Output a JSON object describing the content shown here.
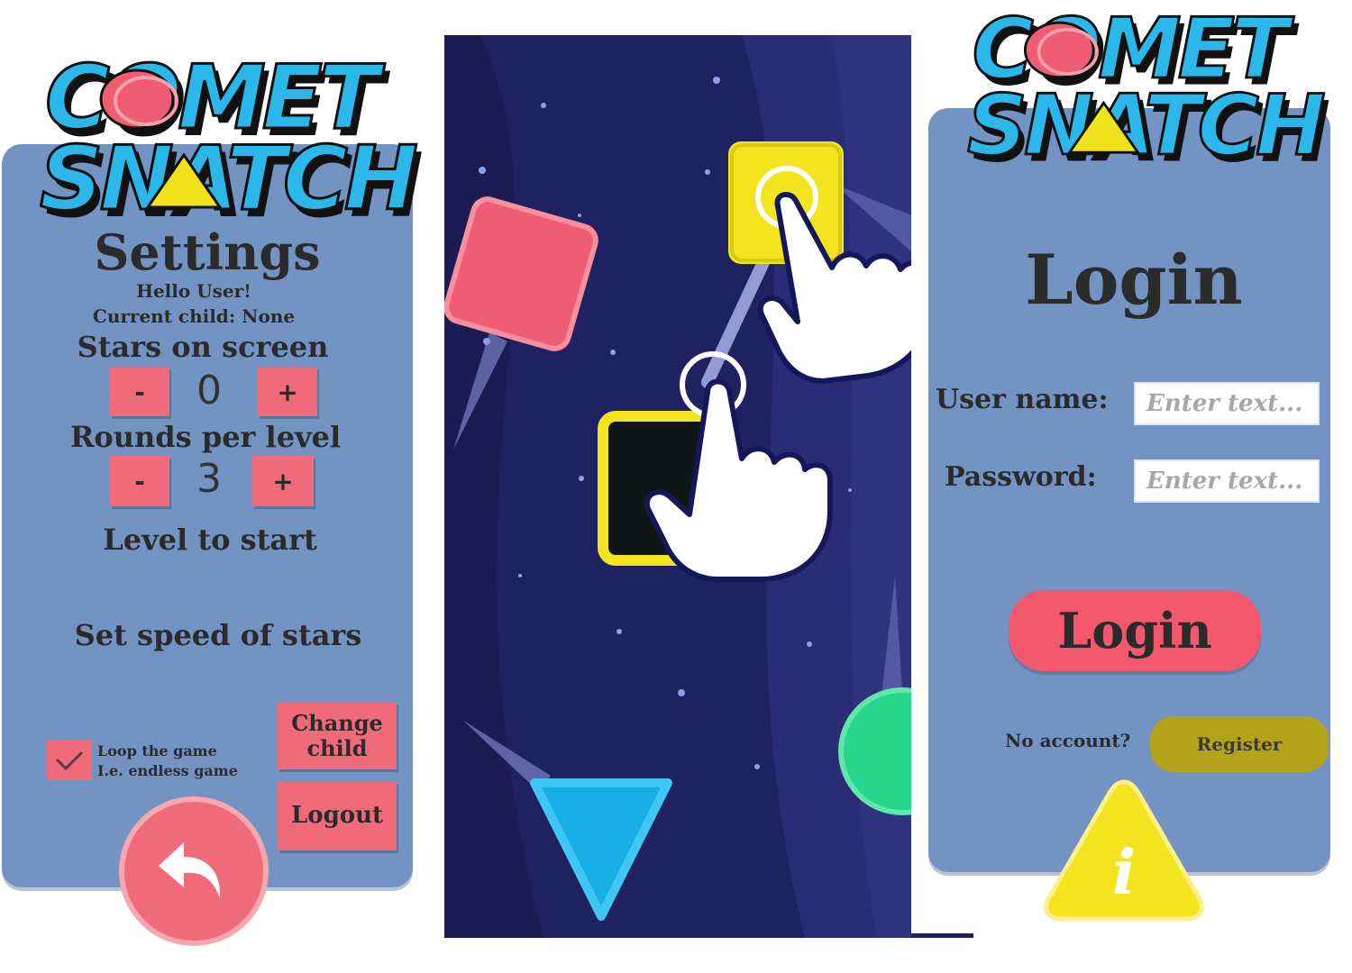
{
  "brand": {
    "line1": "COMET",
    "line2": "SNATCH"
  },
  "settings": {
    "title": "Settings",
    "greeting": "Hello User!",
    "current_child": "Current child: None",
    "stars_label": "Stars on screen",
    "stars_value": "0",
    "rounds_label": "Rounds per level",
    "rounds_value": "3",
    "minus": "-",
    "plus": "+",
    "level_label": "Level to start",
    "speed_label": "Set speed of stars",
    "loop_label_1": "Loop the game",
    "loop_label_2": "I.e. endless game",
    "loop_checked": true,
    "change_child_1": "Change",
    "change_child_2": "child",
    "logout": "Logout"
  },
  "game": {
    "shapes": [
      "red-square",
      "yellow-square",
      "black-square",
      "blue-triangle",
      "green-circle"
    ],
    "icons": [
      "hand-pointer-icon",
      "hand-pointer-icon"
    ]
  },
  "login": {
    "title": "Login",
    "username_label": "User name:",
    "password_label": "Password:",
    "username_placeholder": "Enter text...",
    "password_placeholder": "Enter text...",
    "login_button": "Login",
    "no_account": "No account?",
    "register_button": "Register",
    "info_glyph": "i"
  },
  "colors": {
    "panel": "#7393c2",
    "pink": "#f06b7a",
    "logo_blue": "#2bb7ea",
    "logo_yellow": "#f1e31b",
    "space": "#1f2260",
    "register": "#b4a21b"
  }
}
